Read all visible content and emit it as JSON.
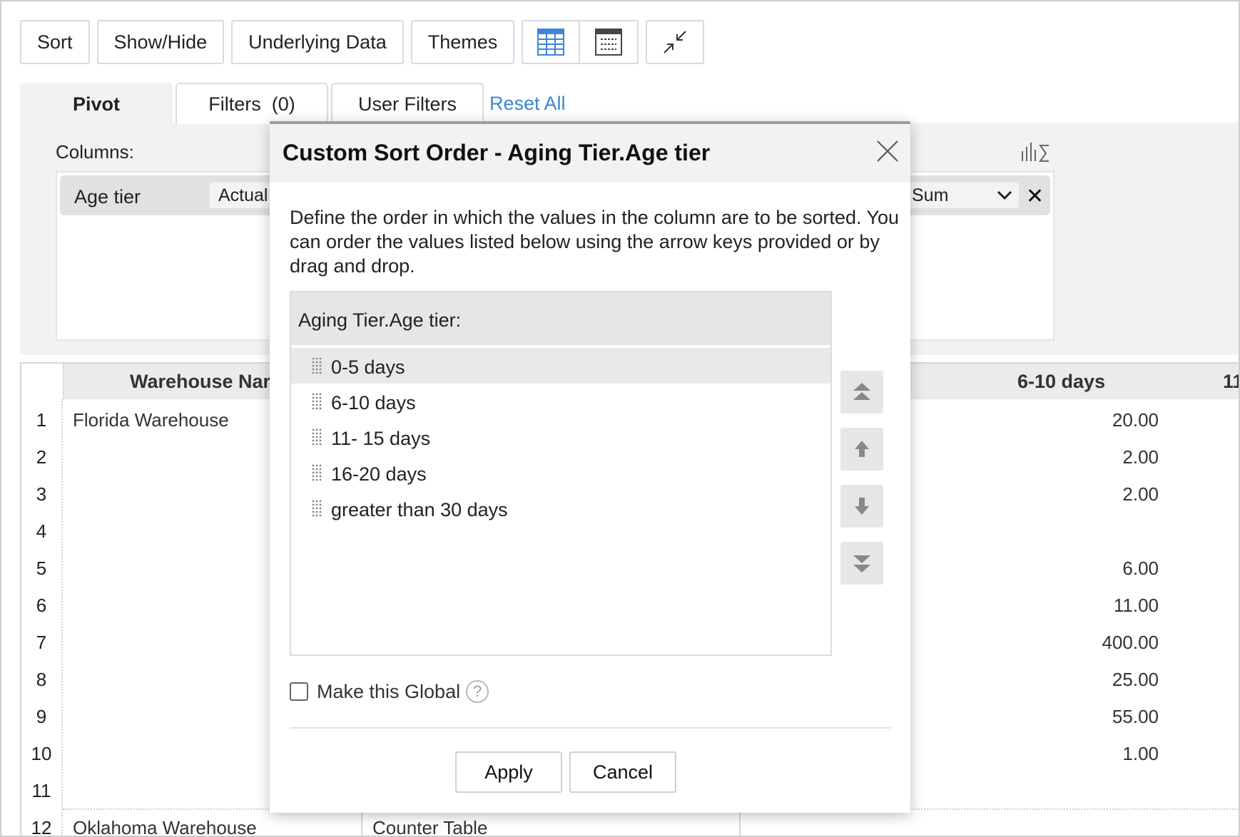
{
  "toolbar": {
    "sort_label": "Sort",
    "showhide_label": "Show/Hide",
    "underlying_label": "Underlying Data",
    "themes_label": "Themes",
    "icons": [
      "tabular-view-icon",
      "compact-view-icon",
      "collapse-icon"
    ]
  },
  "tabs": {
    "pivot": "Pivot",
    "filters": "Filters  (0)",
    "user_filters": "User Filters",
    "reset_all": "Reset All"
  },
  "pivot_panel": {
    "columns_label": "Columns:",
    "column_field": "Age tier",
    "column_agg_partial": "Actual",
    "data_agg": "Sum"
  },
  "table": {
    "header_warehouse": "Warehouse Nar",
    "header_6_10": "6-10 days",
    "header_next": "11",
    "rows": [
      {
        "num": "1",
        "warehouse": "Florida Warehouse",
        "value": "20.00"
      },
      {
        "num": "2",
        "warehouse": "",
        "value": "2.00"
      },
      {
        "num": "3",
        "warehouse": "",
        "value": "2.00"
      },
      {
        "num": "4",
        "warehouse": "",
        "value": ""
      },
      {
        "num": "5",
        "warehouse": "",
        "value": "6.00"
      },
      {
        "num": "6",
        "warehouse": "",
        "value": "11.00"
      },
      {
        "num": "7",
        "warehouse": "",
        "value": "400.00"
      },
      {
        "num": "8",
        "warehouse": "",
        "value": "25.00"
      },
      {
        "num": "9",
        "warehouse": "",
        "value": "55.00"
      },
      {
        "num": "10",
        "warehouse": "",
        "value": "1.00"
      },
      {
        "num": "11",
        "warehouse": "",
        "value": ""
      },
      {
        "num": "12",
        "warehouse": "Oklahoma Warehouse",
        "value": ""
      }
    ],
    "row12_col2": "Counter Table"
  },
  "modal": {
    "title": "Custom Sort Order - Aging Tier.Age tier",
    "description": "Define the order in which the values in the column are to be sorted. You can order the values listed below using the arrow keys provided or by drag and drop.",
    "list_header": "Aging Tier.Age tier:",
    "items": [
      "0-5 days",
      "6-10 days",
      "11- 15 days",
      "16-20 days",
      "greater than 30 days"
    ],
    "selected_index": 0,
    "global_label": "Make this Global",
    "help_glyph": "?",
    "apply_label": "Apply",
    "cancel_label": "Cancel"
  },
  "colors": {
    "link": "#3b86d6",
    "panel_bg": "#f2f2f2",
    "header_bg": "#ebebeb"
  }
}
